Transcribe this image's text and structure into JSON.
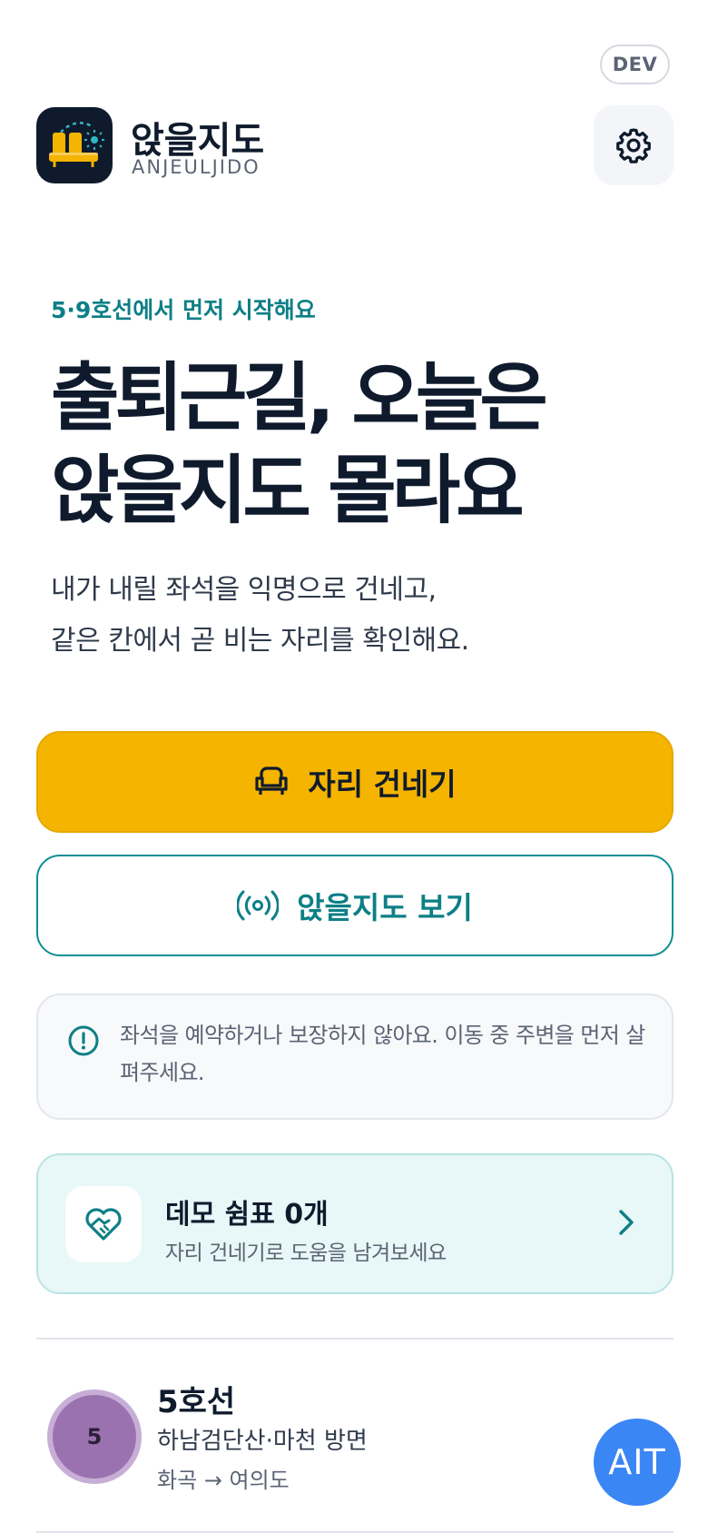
{
  "header": {
    "env_badge": "DEV",
    "app_name": "앉을지도",
    "app_subtitle": "ANJEULJIDO",
    "settings_icon": "gear-icon"
  },
  "hero": {
    "eyebrow": "5·9호선에서 먼저 시작해요",
    "title_line1": "출퇴근길, 오늘은",
    "title_line2": "앉을지도 몰라요",
    "desc_line1": "내가 내릴 좌석을 익명으로 건네고,",
    "desc_line2": "같은 칸에서 곧 비는 자리를 확인해요."
  },
  "actions": {
    "primary_label": "자리 건네기",
    "primary_icon": "armchair-icon",
    "secondary_label": "앉을지도 보기",
    "secondary_icon": "broadcast-icon"
  },
  "notice": {
    "icon": "info-circle-icon",
    "text": "좌석을 예약하거나 보장하지 않아요. 이동 중 주변을 먼저 살펴주세요."
  },
  "rest_card": {
    "icon": "heart-hand-icon",
    "title": "데모 쉼표 0개",
    "subtitle": "자리 건네기로 도움을 남겨보세요"
  },
  "lines": [
    {
      "badge": "5",
      "name": "5호선",
      "direction": "하남검단산·마천 방면",
      "route": "화곡 → 여의도",
      "color": "#9b72b0"
    }
  ],
  "fab": {
    "label": "AIT",
    "color": "#3b86f5"
  },
  "colors": {
    "accent": "#f5b400",
    "teal": "#0d7f86",
    "navy": "#0f1b2d"
  }
}
